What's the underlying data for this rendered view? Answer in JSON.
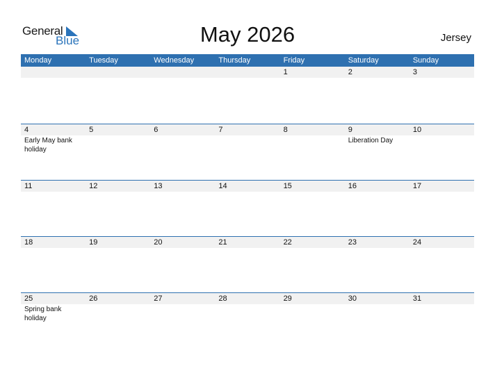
{
  "logo": {
    "general": "General",
    "blue": "Blue"
  },
  "title": "May 2026",
  "country": "Jersey",
  "weekdays": [
    "Monday",
    "Tuesday",
    "Wednesday",
    "Thursday",
    "Friday",
    "Saturday",
    "Sunday"
  ],
  "weeks": [
    {
      "days": [
        "",
        "",
        "",
        "",
        "1",
        "2",
        "3"
      ],
      "events": [
        "",
        "",
        "",
        "",
        "",
        "",
        ""
      ]
    },
    {
      "days": [
        "4",
        "5",
        "6",
        "7",
        "8",
        "9",
        "10"
      ],
      "events": [
        "Early May bank holiday",
        "",
        "",
        "",
        "",
        "Liberation Day",
        ""
      ]
    },
    {
      "days": [
        "11",
        "12",
        "13",
        "14",
        "15",
        "16",
        "17"
      ],
      "events": [
        "",
        "",
        "",
        "",
        "",
        "",
        ""
      ]
    },
    {
      "days": [
        "18",
        "19",
        "20",
        "21",
        "22",
        "23",
        "24"
      ],
      "events": [
        "",
        "",
        "",
        "",
        "",
        "",
        ""
      ]
    },
    {
      "days": [
        "25",
        "26",
        "27",
        "28",
        "29",
        "30",
        "31"
      ],
      "events": [
        "Spring bank holiday",
        "",
        "",
        "",
        "",
        "",
        ""
      ]
    }
  ],
  "colors": {
    "header": "#2e70b0",
    "brand_blue": "#2a74bb",
    "day_row": "#f1f1f1"
  }
}
